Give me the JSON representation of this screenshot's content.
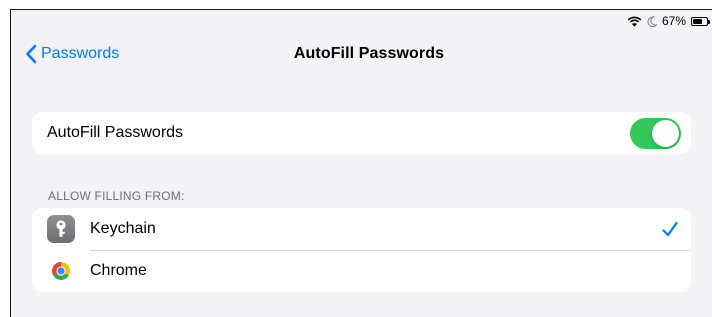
{
  "status_bar": {
    "battery_text": "67%",
    "battery_level_percent": 67
  },
  "nav": {
    "back_label": "Passwords",
    "title": "AutoFill Passwords"
  },
  "autofill": {
    "label": "AutoFill Passwords",
    "enabled": true
  },
  "allow_filling": {
    "header": "ALLOW FILLING FROM:",
    "items": [
      {
        "label": "Keychain",
        "icon": "keychain-icon",
        "checked": true
      },
      {
        "label": "Chrome",
        "icon": "chrome-icon",
        "checked": false
      }
    ]
  },
  "colors": {
    "accent": "#007aff",
    "toggle_on": "#34c759",
    "background": "#f2f2f7"
  }
}
